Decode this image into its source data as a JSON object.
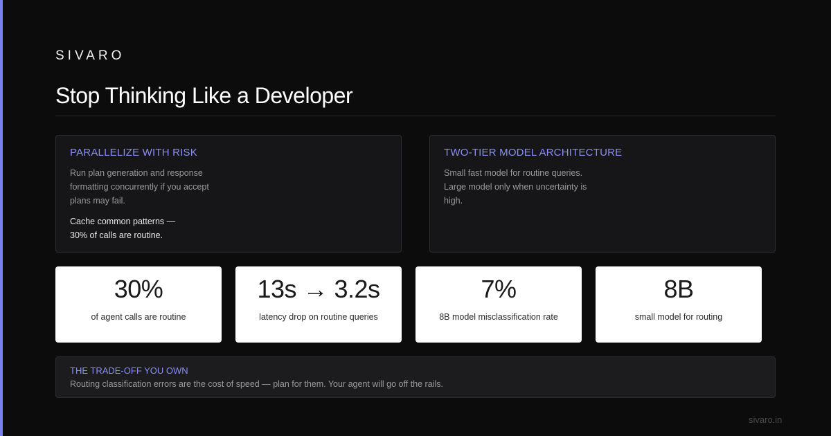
{
  "brand": "SIVARO",
  "title": "Stop Thinking Like a Developer",
  "colors": {
    "background": "#0c0c0c",
    "accent": "#7b80f0",
    "card": "#161618",
    "stat_card": "#ffffff"
  },
  "cards": [
    {
      "heading": "PARALLELIZE WITH RISK",
      "text": "Run plan generation and response formatting concurrently if you accept plans may fail.",
      "emphasis": "Cache common patterns — 30% of calls are routine."
    },
    {
      "heading": "TWO-TIER MODEL ARCHITECTURE",
      "text": "Small fast model for routine queries. Large model only when uncertainty is high."
    }
  ],
  "stats": [
    {
      "value": "30%",
      "label": "of agent calls are routine"
    },
    {
      "value": "13s → 3.2s",
      "label": "latency drop on routine queries"
    },
    {
      "value": "7%",
      "label": "8B model misclassification rate"
    },
    {
      "value": "8B",
      "label": "small model for routing"
    }
  ],
  "note": {
    "heading": "THE TRADE-OFF YOU OWN",
    "text": "Routing classification errors are the cost of speed — plan for them. Your agent will go off the rails."
  },
  "footer": "sivaro.in"
}
